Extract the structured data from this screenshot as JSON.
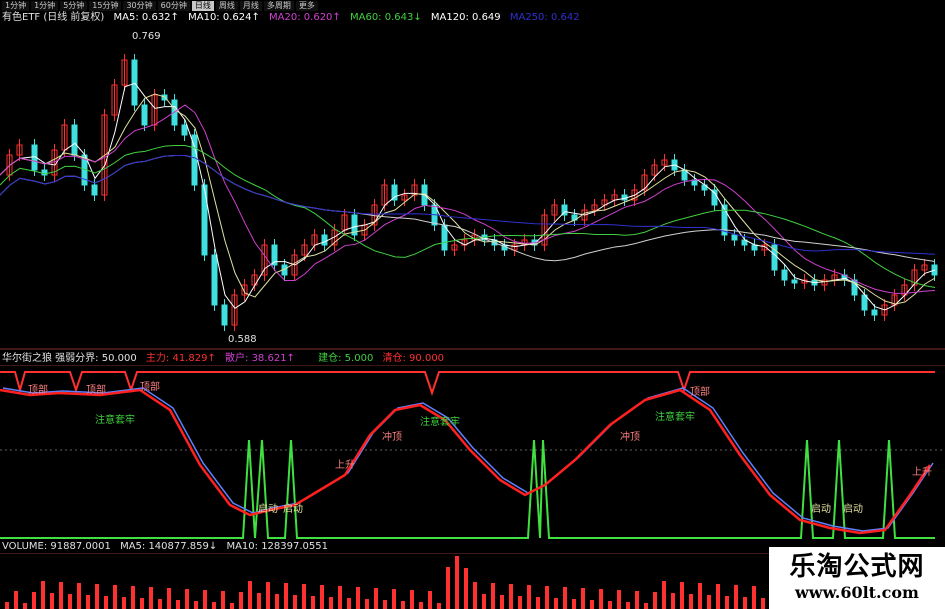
{
  "toolbar": {
    "items": [
      "1分钟",
      "1分钟",
      "5分钟",
      "15分钟",
      "30分钟",
      "60分钟",
      "日线",
      "周线",
      "月线",
      "多周期",
      "更多"
    ],
    "active_index": 6
  },
  "main_panel": {
    "title": "有色ETF (日线 前复权)",
    "ma": [
      {
        "label": "MA5: 0.632↑",
        "color": "#ffffff"
      },
      {
        "label": "MA10: 0.624↑",
        "color": "#ffffff"
      },
      {
        "label": "MA20: 0.620↑",
        "color": "#d040d0"
      },
      {
        "label": "MA60: 0.643↓",
        "color": "#40d040"
      },
      {
        "label": "MA120: 0.649",
        "color": "#ffffff"
      },
      {
        "label": "MA250: 0.642",
        "color": "#3030d0"
      }
    ],
    "price_high": "0.769",
    "price_low": "0.588"
  },
  "indicator_panel": {
    "title": "华尔街之狼 强弱分界: 50.000",
    "items": [
      {
        "label": "主力: 41.829↑",
        "color": "#ff3030"
      },
      {
        "label": "散户: 38.621↑",
        "color": "#d040d0"
      },
      {
        "label": "建仓: 5.000",
        "color": "#40d040"
      },
      {
        "label": "清仓: 90.000",
        "color": "#ff3030"
      }
    ],
    "annotations": [
      {
        "text": "顶部"
      },
      {
        "text": "顶部"
      },
      {
        "text": "顶部"
      },
      {
        "text": "注意套牢"
      },
      {
        "text": "注意套牢"
      },
      {
        "text": "注意套牢"
      },
      {
        "text": "冲顶"
      },
      {
        "text": "冲顶"
      },
      {
        "text": "上升"
      },
      {
        "text": "上升"
      },
      {
        "text": "启动"
      },
      {
        "text": "启动"
      },
      {
        "text": "启动"
      },
      {
        "text": "启动"
      },
      {
        "text": "顶部"
      }
    ]
  },
  "volume_panel": {
    "volume": "VOLUME: 91887.0001",
    "ma5": "MA5: 140877.859↓",
    "ma10": "MA10: 128397.0551"
  },
  "watermark": {
    "line1": "乐淘公式网",
    "line2": "www.60lt.com"
  },
  "colors": {
    "up_candle": "#ff3030",
    "down_candle": "#40e0e0",
    "main_line": "#ff2020",
    "retail_line": "#6080ff",
    "signal_line": "#40e040",
    "upper_line": "#ff3030"
  }
}
